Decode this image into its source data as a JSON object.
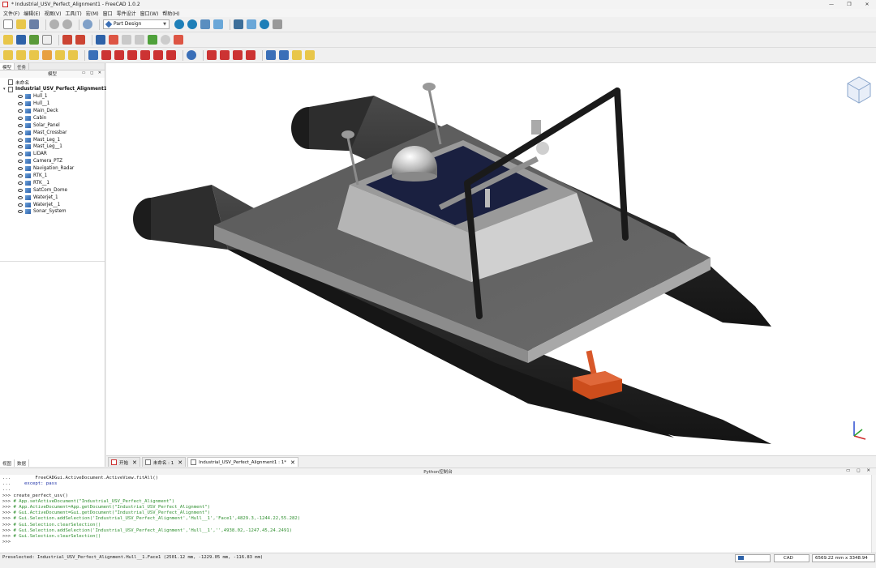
{
  "window": {
    "title": "* Industrial_USV_Perfect_Alignment1 - FreeCAD 1.0.2",
    "controls": [
      "—",
      "❐",
      "✕"
    ]
  },
  "menu": [
    "文件(F)",
    "编辑(E)",
    "视图(V)",
    "工具(T)",
    "宏(M)",
    "窗口",
    "零件设计",
    "窗口(W)",
    "帮助(H)"
  ],
  "toolbar": {
    "workbench": "Part Design"
  },
  "panel": {
    "tabs": [
      "模型",
      "任务"
    ],
    "header": "模型",
    "bottom_tabs": [
      "视图",
      "数据"
    ],
    "tree": [
      {
        "label": "未命名",
        "type": "doc",
        "indent": 0
      },
      {
        "label": "Industrial_USV_Perfect_Alignment1",
        "type": "doc",
        "indent": 0,
        "bold": true
      },
      {
        "label": "Hull_1",
        "type": "obj",
        "indent": 1
      },
      {
        "label": "Hull__1",
        "type": "obj",
        "indent": 1
      },
      {
        "label": "Main_Deck",
        "type": "obj",
        "indent": 1
      },
      {
        "label": "Cabin",
        "type": "obj",
        "indent": 1
      },
      {
        "label": "Solar_Panel",
        "type": "obj",
        "indent": 1
      },
      {
        "label": "Mast_Crossbar",
        "type": "obj",
        "indent": 1
      },
      {
        "label": "Mast_Leg_1",
        "type": "obj",
        "indent": 1
      },
      {
        "label": "Mast_Leg__1",
        "type": "obj",
        "indent": 1
      },
      {
        "label": "LiDAR",
        "type": "obj",
        "indent": 1
      },
      {
        "label": "Camera_PTZ",
        "type": "obj",
        "indent": 1
      },
      {
        "label": "Navigation_Radar",
        "type": "obj",
        "indent": 1
      },
      {
        "label": "RTK_1",
        "type": "obj",
        "indent": 1
      },
      {
        "label": "RTK__1",
        "type": "obj",
        "indent": 1
      },
      {
        "label": "SatCom_Dome",
        "type": "obj",
        "indent": 1
      },
      {
        "label": "Waterjet_1",
        "type": "obj",
        "indent": 1
      },
      {
        "label": "Waterjet__1",
        "type": "obj",
        "indent": 1
      },
      {
        "label": "Sonar_System",
        "type": "obj",
        "indent": 1
      }
    ]
  },
  "doc_tabs": [
    {
      "label": "开始",
      "active": false
    },
    {
      "label": "未命名 : 1",
      "active": false
    },
    {
      "label": "Industrial_USV_Perfect_Alignment1 : 1*",
      "active": true
    }
  ],
  "python": {
    "header": "Python控制台",
    "lines": [
      {
        "p": "...",
        "t": "        FreeCADGui.ActiveDocument.ActiveView.fitAll()",
        "c": "tx"
      },
      {
        "p": "...",
        "t": "    except: pass",
        "c": "kw"
      },
      {
        "p": "...",
        "t": "",
        "c": "tx"
      },
      {
        "p": ">>>",
        "t": "create_perfect_usv()",
        "c": "tx"
      },
      {
        "p": ">>>",
        "t": "# App.setActiveDocument(\"Industrial_USV_Perfect_Alignment\")",
        "c": "cm"
      },
      {
        "p": ">>>",
        "t": "# App.ActiveDocument=App.getDocument(\"Industrial_USV_Perfect_Alignment\")",
        "c": "cm"
      },
      {
        "p": ">>>",
        "t": "# Gui.ActiveDocument=Gui.getDocument(\"Industrial_USV_Perfect_Alignment\")",
        "c": "cm"
      },
      {
        "p": ">>>",
        "t": "# Gui.Selection.addSelection('Industrial_USV_Perfect_Alignment','Hull__1','Face1',4829.3,-1244.22,55.282)",
        "c": "cm"
      },
      {
        "p": ">>>",
        "t": "# Gui.Selection.clearSelection()",
        "c": "cm"
      },
      {
        "p": ">>>",
        "t": "# Gui.Selection.addSelection('Industrial_USV_Perfect_Alignment','Hull__1','',4938.02,-1247.45,24.2491)",
        "c": "cm"
      },
      {
        "p": ">>>",
        "t": "# Gui.Selection.clearSelection()",
        "c": "cm"
      },
      {
        "p": ">>>",
        "t": "",
        "c": "tx"
      }
    ]
  },
  "status": {
    "message": "Preselected: Industrial_USV_Perfect_Alignment.Hull__1.Face1 (2501.12 mm, -1229.05 mm, -116.83 mm)",
    "nav_style": "CAD",
    "dimensions": "6569.22 mm x 3348.94 mm"
  }
}
